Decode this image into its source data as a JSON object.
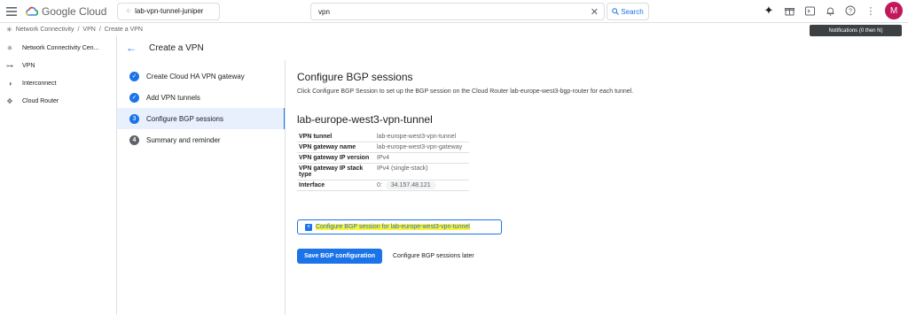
{
  "topbar": {
    "brand": "Google Cloud",
    "project": "lab-vpn-tunnel-juniper",
    "search_value": "vpn",
    "search_button": "Search",
    "avatar_letter": "M",
    "tooltip": "Notifications (0 then N)"
  },
  "breadcrumb": {
    "items": [
      "Network Connectivity",
      "/",
      "VPN",
      "/",
      "Create a VPN"
    ]
  },
  "sidenav": {
    "items": [
      {
        "label": "Network Connectivity Cen...",
        "icon": "network-connectivity-icon"
      },
      {
        "label": "VPN",
        "icon": "vpn-icon"
      },
      {
        "label": "Interconnect",
        "icon": "interconnect-icon"
      },
      {
        "label": "Cloud Router",
        "icon": "cloud-router-icon"
      }
    ]
  },
  "header": {
    "title": "Create a VPN"
  },
  "steps": [
    {
      "label": "Create Cloud HA VPN gateway",
      "state": "done"
    },
    {
      "label": "Add VPN tunnels",
      "state": "done"
    },
    {
      "label": "Configure BGP sessions",
      "state": "active",
      "num": "3"
    },
    {
      "label": "Summary and reminder",
      "state": "todo",
      "num": "4"
    }
  ],
  "main": {
    "title": "Configure BGP sessions",
    "description": "Click Configure BGP Session to set up the BGP session on the Cloud Router lab-europe-west3-bgp-router for each tunnel.",
    "tunnel_title": "lab-europe-west3-vpn-tunnel",
    "details": [
      {
        "key": "VPN tunnel",
        "value": "lab-europe-west3-vpn-tunnel"
      },
      {
        "key": "VPN gateway name",
        "value": "lab-europe-west3-vpn-gateway"
      },
      {
        "key": "VPN gateway IP version",
        "value": "IPv4"
      },
      {
        "key": "VPN gateway IP stack type",
        "value": "IPv4 (single-stack)"
      },
      {
        "key": "Interface",
        "value": "0:",
        "chip": "34.157.48.121"
      }
    ],
    "configure_bgp_button": "Configure BGP session for lab-europe-west3-vpn-tunnel",
    "save_button": "Save BGP configuration",
    "later_button": "Configure BGP sessions later"
  },
  "colors": {
    "accent": "#1a73e8",
    "highlight": "#fff23a",
    "avatar": "#c2185b"
  }
}
